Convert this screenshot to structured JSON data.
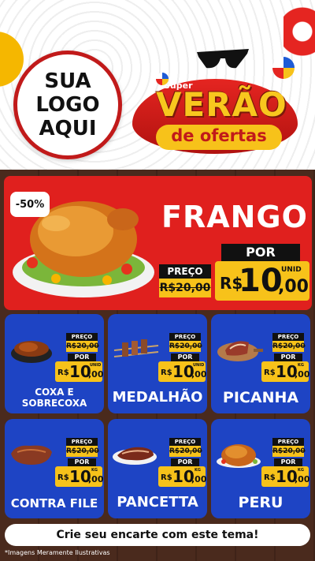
{
  "header": {
    "logo_lines": [
      "SUA",
      "LOGO",
      "AQUI"
    ],
    "promo_super": "Super",
    "promo_title": "VERÃO",
    "promo_subtitle": "de ofertas"
  },
  "hero": {
    "discount": "-50%",
    "name": "FRANGO",
    "preco_label": "PREÇO",
    "old_price": "R$20,00",
    "por_label": "POR",
    "currency": "R$",
    "price_int": "10",
    "price_dec": ",00",
    "unit": "UNID"
  },
  "products": [
    {
      "name_lines": [
        "COXA E",
        "SOBRECOXA"
      ],
      "icon": "chicken-pot-icon",
      "preco_label": "PREÇO",
      "old_price": "R$20,00",
      "por_label": "POR",
      "currency": "R$",
      "price_int": "10",
      "price_dec": ",00",
      "unit": "UNID"
    },
    {
      "name_lines": [
        "MEDALHÃO"
      ],
      "icon": "skewers-icon",
      "preco_label": "PREÇO",
      "old_price": "R$20,00",
      "por_label": "POR",
      "currency": "R$",
      "price_int": "10",
      "price_dec": ",00",
      "unit": "UNID"
    },
    {
      "name_lines": [
        "PICANHA"
      ],
      "icon": "picanha-board-icon",
      "preco_label": "PREÇO",
      "old_price": "R$20,00",
      "por_label": "POR",
      "currency": "R$",
      "price_int": "10",
      "price_dec": ",00",
      "unit": "KG"
    },
    {
      "name_lines": [
        "CONTRA FILE"
      ],
      "icon": "steak-icon",
      "preco_label": "PREÇO",
      "old_price": "R$20,00",
      "por_label": "POR",
      "currency": "R$",
      "price_int": "10",
      "price_dec": ",00",
      "unit": "KG"
    },
    {
      "name_lines": [
        "PANCETTA"
      ],
      "icon": "pancetta-icon",
      "preco_label": "PREÇO",
      "old_price": "R$20,00",
      "por_label": "POR",
      "currency": "R$",
      "price_int": "10",
      "price_dec": ",00",
      "unit": "KG"
    },
    {
      "name_lines": [
        "PERU"
      ],
      "icon": "turkey-icon",
      "preco_label": "PREÇO",
      "old_price": "R$20,00",
      "por_label": "POR",
      "currency": "R$",
      "price_int": "10",
      "price_dec": ",00",
      "unit": "KG"
    }
  ],
  "footer": {
    "cta": "Crie seu encarte com este tema!",
    "disclaimer": "*Imagens Meramente Ilustrativas"
  },
  "colors": {
    "red": "#e0201e",
    "blue": "#1e44c4",
    "yellow": "#f7c21a",
    "black": "#111111",
    "wood": "#4a2a1d"
  }
}
